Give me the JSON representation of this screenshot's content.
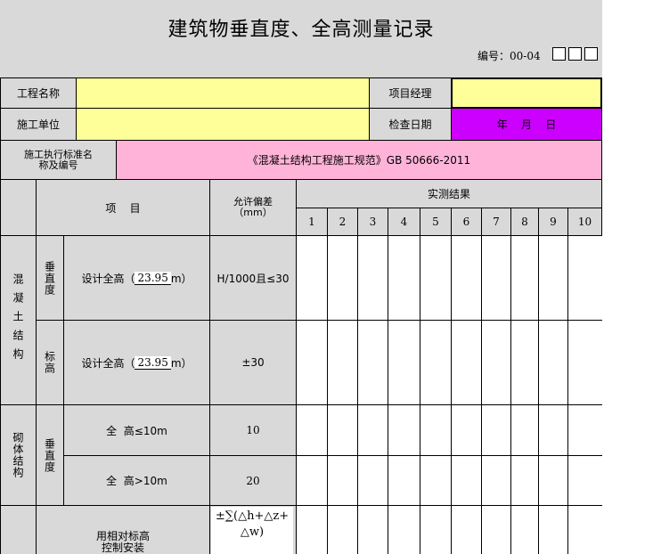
{
  "form": {
    "title": "建筑物垂直度、全高测量记录",
    "doc_no_label": "编号：00-04"
  },
  "header": {
    "project_name_label": "工程名称",
    "project_name_value": "",
    "project_manager_label": "项目经理",
    "project_manager_value": "",
    "construction_unit_label": "施工单位",
    "construction_unit_value": "",
    "inspection_date_label": "检查日期",
    "inspection_date_value": "年    月    日",
    "standard_label": "施工执行标准名称及编号",
    "standard_value": "《混凝土结构工程施工规范》GB 50666-2011"
  },
  "table_head": {
    "item": "项    目",
    "tolerance_line1": "允许偏差",
    "tolerance_line2": "（mm）",
    "results": "实测结果",
    "columns": [
      "1",
      "2",
      "3",
      "4",
      "5",
      "6",
      "7",
      "8",
      "9",
      "10"
    ]
  },
  "concrete": {
    "group": "混凝土结构",
    "verticality": "垂直度",
    "verticality_item_prefix": "设计全高（",
    "verticality_height": "23.95",
    "item_suffix": "m）",
    "verticality_tolerance": "H/1000且≤30",
    "elevation": "标高",
    "elevation_item_prefix": "设计全高（",
    "elevation_height": "23.95",
    "elevation_tolerance": "±30"
  },
  "masonry": {
    "group": "砌体结构",
    "verticality": "垂直度",
    "row1_item": "全  高≤10m",
    "row1_tolerance": "10",
    "row2_item": "全  高>10m",
    "row2_tolerance": "20"
  },
  "last_row": {
    "item_line1": "用相对标高",
    "item_line2": "控制安装",
    "tolerance_line1": "±∑(△h+△z+",
    "tolerance_line2": "△w)"
  }
}
